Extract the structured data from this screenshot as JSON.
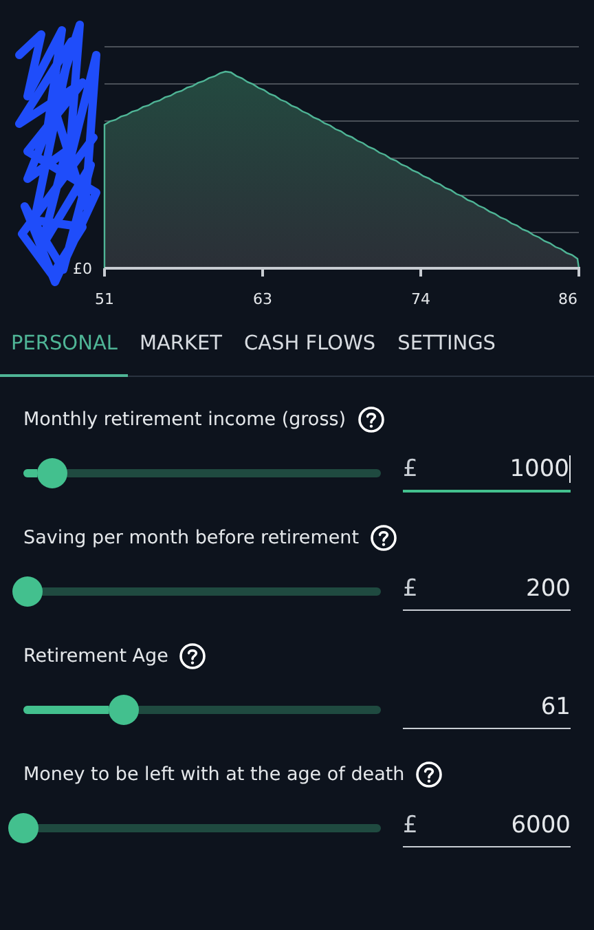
{
  "chart": {
    "y_labels": [
      "£0"
    ],
    "x_labels": [
      "51",
      "63",
      "74",
      "86"
    ]
  },
  "tabs": [
    {
      "label": "PERSONAL",
      "selected": true
    },
    {
      "label": "MARKET",
      "selected": false
    },
    {
      "label": "CASH FLOWS",
      "selected": false
    },
    {
      "label": "SETTINGS",
      "selected": false
    }
  ],
  "fields": [
    {
      "label": "Monthly retirement income (gross)",
      "level": 0.08,
      "currency": "£",
      "value": "1000",
      "focused": true
    },
    {
      "label": "Saving per month before retirement",
      "level": 0.01,
      "currency": "£",
      "value": "200",
      "focused": false
    },
    {
      "label": "Retirement Age",
      "level": 0.28,
      "value": "61",
      "focused": false
    },
    {
      "label": "Money to be left with at the age of death",
      "level": 0.0,
      "currency": "£",
      "value": "6000",
      "focused": false
    }
  ]
}
